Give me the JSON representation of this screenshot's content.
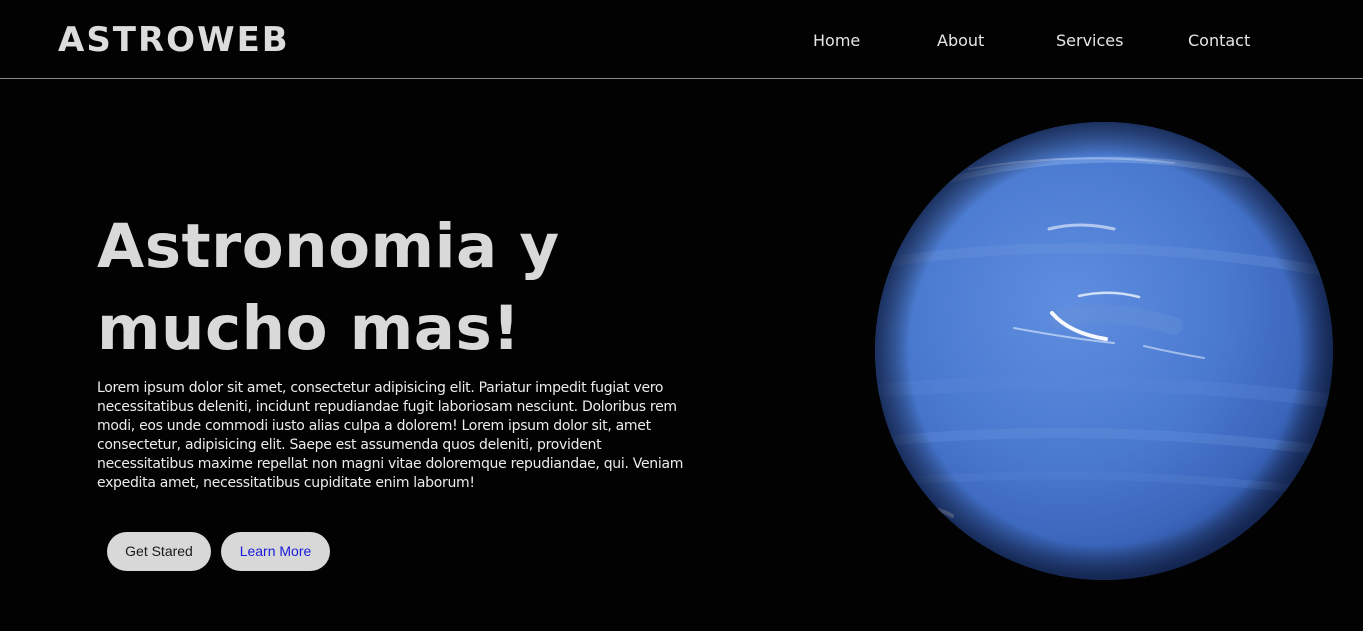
{
  "header": {
    "brand": "ASTROWEB",
    "nav": [
      {
        "label": "Home"
      },
      {
        "label": "About"
      },
      {
        "label": "Services"
      },
      {
        "label": "Contact"
      }
    ]
  },
  "hero": {
    "title_line1": "Astronomia y",
    "title_line2": "mucho mas!",
    "body": "Lorem ipsum dolor sit amet, consectetur adipisicing elit. Pariatur impedit fugiat vero necessitatibus deleniti, incidunt repudiandae fugit laboriosam nesciunt. Doloribus rem modi, eos unde commodi iusto alias culpa a dolorem! Lorem ipsum dolor sit, amet consectetur, adipisicing elit. Saepe est assumenda quos deleniti, provident necessitatibus maxime repellat non magni vitae doloremque repudiandae, qui. Veniam expedita amet, necessitatibus cupiditate enim laborum!",
    "buttons": {
      "primary": "Get Stared",
      "secondary": "Learn More"
    },
    "image": "planet-neptune"
  },
  "colors": {
    "background": "#020202",
    "text": "#e0e0e0",
    "button_bg": "#d8d8d8",
    "link_button_text": "#1a1adc",
    "planet": "#4f7fd4"
  }
}
